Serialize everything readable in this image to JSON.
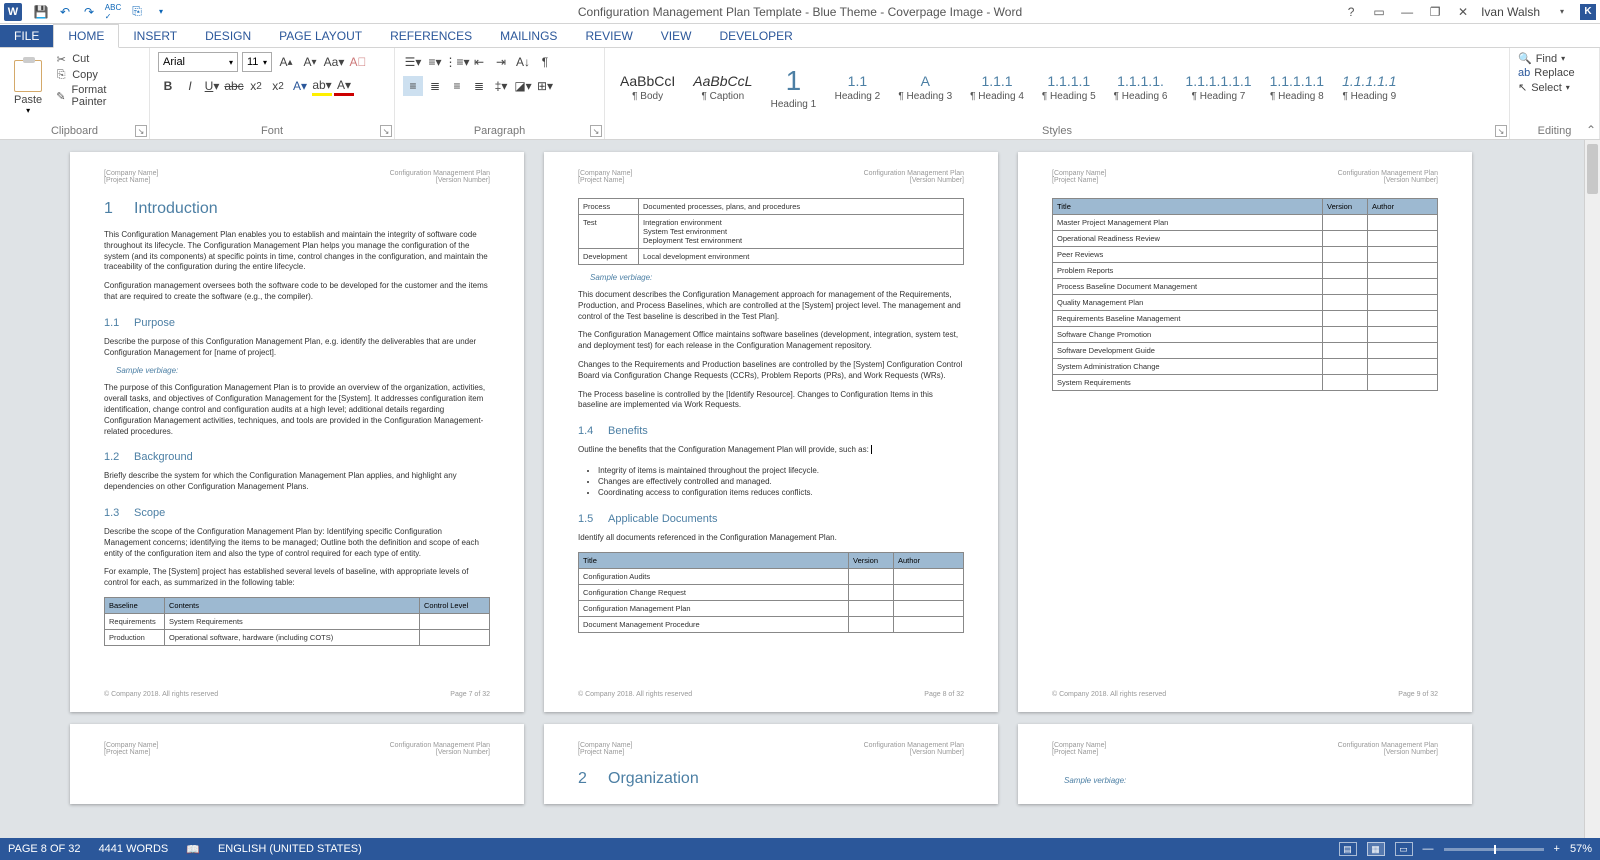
{
  "app": {
    "title": "Configuration Management Plan Template - Blue Theme - Coverpage Image - Word",
    "user": "Ivan Walsh",
    "account_letter": "K"
  },
  "qat": {
    "save": "💾",
    "undo": "↶",
    "redo": "↷",
    "spell": "ᴬᴮᶜ",
    "custom": "⎙"
  },
  "tabs": {
    "file": "FILE",
    "home": "HOME",
    "insert": "INSERT",
    "design": "DESIGN",
    "page_layout": "PAGE LAYOUT",
    "references": "REFERENCES",
    "mailings": "MAILINGS",
    "review": "REVIEW",
    "view": "VIEW",
    "developer": "DEVELOPER"
  },
  "ribbon": {
    "clipboard": {
      "label": "Clipboard",
      "paste": "Paste",
      "cut": "Cut",
      "copy": "Copy",
      "format_painter": "Format Painter"
    },
    "font": {
      "label": "Font",
      "name": "Arial",
      "size": "11"
    },
    "paragraph": {
      "label": "Paragraph"
    },
    "styles": {
      "label": "Styles",
      "items": [
        {
          "preview": "AaBbCcI",
          "name": "¶ Body"
        },
        {
          "preview": "AaBbCcL",
          "name": "¶ Caption",
          "italic": true
        },
        {
          "preview": "1",
          "name": "Heading 1",
          "big": true
        },
        {
          "preview": "1.1",
          "name": "Heading 2"
        },
        {
          "preview": "A",
          "name": "¶ Heading 3"
        },
        {
          "preview": "1.1.1",
          "name": "¶ Heading 4"
        },
        {
          "preview": "1.1.1.1",
          "name": "¶ Heading 5"
        },
        {
          "preview": "1.1.1.1.",
          "name": "¶ Heading 6"
        },
        {
          "preview": "1.1.1.1.1.1",
          "name": "¶ Heading 7"
        },
        {
          "preview": "1.1.1.1.1",
          "name": "¶ Heading 8"
        },
        {
          "preview": "1.1.1.1.1",
          "name": "¶ Heading 9",
          "italic": true
        }
      ]
    },
    "editing": {
      "label": "Editing",
      "find": "Find",
      "replace": "Replace",
      "select": "Select"
    }
  },
  "doc": {
    "header": {
      "company": "[Company Name]",
      "project": "[Project Name]",
      "rtitle": "Configuration Management Plan",
      "version": "[Version Number]"
    },
    "footer": {
      "copyright": "© Company 2018. All rights reserved"
    },
    "p7": {
      "pagenum": "Page 7 of 32",
      "h1_num": "1",
      "h1": "Introduction",
      "intro1": "This Configuration Management Plan enables you to establish and maintain the integrity of software code throughout its lifecycle. The Configuration Management Plan helps you manage the configuration of the system (and its components) at specific points in time, control changes in the configuration, and maintain the traceability of the configuration during the entire lifecycle.",
      "intro2": "Configuration management oversees both the software code to be developed for the customer and the items that are required to create the software (e.g., the compiler).",
      "s11_num": "1.1",
      "s11": "Purpose",
      "s11_p1": "Describe the purpose of this Configuration Management Plan, e.g. identify the deliverables that are under Configuration Management for [name of project].",
      "verbiage": "Sample verbiage:",
      "s11_p2": "The purpose of this Configuration Management Plan is to provide an overview of the organization, activities, overall tasks, and objectives of Configuration Management for the [System].  It addresses configuration item identification, change control and configuration audits at a high level; additional details regarding Configuration Management activities, techniques, and tools are provided in the Configuration Management-related procedures.",
      "s12_num": "1.2",
      "s12": "Background",
      "s12_p": "Briefly describe the system for which the Configuration Management Plan applies, and highlight any dependencies on other Configuration Management Plans.",
      "s13_num": "1.3",
      "s13": "Scope",
      "s13_p1": "Describe the scope of the Configuration Management Plan by: Identifying specific Configuration Management concerns; identifying the items to be managed; Outline both the definition and scope of each entity of the configuration item and also the type of control required for each type of entity.",
      "s13_p2": "For example, The [System] project has established several levels of baseline, with appropriate levels of control for each, as summarized in the following table:",
      "tbl1_h1": "Baseline",
      "tbl1_h2": "Contents",
      "tbl1_h3": "Control Level",
      "tbl1_r1c1": "Requirements",
      "tbl1_r1c2": "System Requirements",
      "tbl1_r2c1": "Production",
      "tbl1_r2c2": "Operational software, hardware (including COTS)"
    },
    "p8": {
      "pagenum": "Page 8 of 32",
      "tbl_h1": "Process",
      "tbl_h2": "Documented processes, plans, and procedures",
      "tbl_r1c1": "Test",
      "tbl_r1c2a": "Integration environment",
      "tbl_r1c2b": "System Test environment",
      "tbl_r1c2c": "Deployment Test environment",
      "tbl_r2c1": "Development",
      "tbl_r2c2": "Local development environment",
      "verbiage": "Sample verbiage:",
      "para1": "This document describes the Configuration Management approach for management of the Requirements, Production, and Process Baselines, which are controlled at the [System] project level. The management and control of the Test baseline is described in the Test Plan].",
      "para2": "The Configuration Management Office maintains software baselines (development, integration, system test, and deployment test) for each release in the Configuration Management repository.",
      "para3": "Changes to the Requirements and Production baselines are controlled by the [System] Configuration Control Board via Configuration Change Requests (CCRs), Problem Reports (PRs), and Work Requests (WRs).",
      "para4": "The Process baseline is controlled by the [Identify Resource]. Changes to Configuration Items in this baseline are implemented via Work Requests.",
      "s14_num": "1.4",
      "s14": "Benefits",
      "s14_p": "Outline the benefits that the Configuration Management Plan will provide, such as:",
      "b1": "Integrity of items is maintained throughout the project lifecycle.",
      "b2": "Changes are effectively controlled and managed.",
      "b3": "Coordinating access to configuration items reduces conflicts.",
      "s15_num": "1.5",
      "s15": "Applicable Documents",
      "s15_p": "Identify all documents referenced in the Configuration Management Plan.",
      "tbl2_h1": "Title",
      "tbl2_h2": "Version",
      "tbl2_h3": "Author",
      "tbl2_r1": "Configuration Audits",
      "tbl2_r2": "Configuration Change Request",
      "tbl2_r3": "Configuration Management Plan",
      "tbl2_r4": "Document Management Procedure"
    },
    "p9": {
      "pagenum": "Page 9 of 32",
      "tbl_h1": "Title",
      "tbl_h2": "Version",
      "tbl_h3": "Author",
      "rows": [
        "Master Project Management Plan",
        "Operational Readiness Review",
        "Peer Reviews",
        "Problem Reports",
        "Process Baseline Document Management",
        "Quality Management Plan",
        "Requirements Baseline Management",
        "Software Change Promotion",
        "Software Development Guide",
        "System Administration Change",
        "System Requirements"
      ]
    },
    "p11": {
      "h1_num": "2",
      "h1": "Organization",
      "verbiage": "Sample verbiage:"
    }
  },
  "statusbar": {
    "page": "PAGE 8 OF 32",
    "words": "4441 WORDS",
    "lang": "ENGLISH (UNITED STATES)",
    "zoom": "57%"
  }
}
